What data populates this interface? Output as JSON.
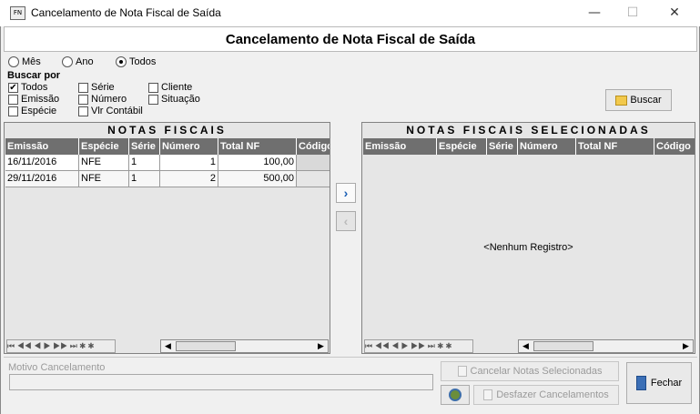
{
  "window": {
    "title": "Cancelamento de Nota Fiscal de Saída",
    "icon_text": "FN",
    "minimize": "—",
    "maximize": "☐",
    "close": "✕"
  },
  "header": {
    "title": "Cancelamento de Nota Fiscal de Saída"
  },
  "period": {
    "options": [
      "Mês",
      "Ano",
      "Todos"
    ],
    "selected": "Todos"
  },
  "search": {
    "label": "Buscar por",
    "checks": [
      {
        "label": "Todos",
        "checked": true
      },
      {
        "label": "Série",
        "checked": false
      },
      {
        "label": "Cliente",
        "checked": false
      },
      {
        "label": "Emissão",
        "checked": false
      },
      {
        "label": "Número",
        "checked": false
      },
      {
        "label": "Situação",
        "checked": false
      },
      {
        "label": "Espécie",
        "checked": false
      },
      {
        "label": "Vlr Contábil",
        "checked": false
      }
    ],
    "button": "Buscar"
  },
  "left_grid": {
    "title": "NOTAS FISCAIS",
    "columns": [
      "Emissão",
      "Espécie",
      "Série",
      "Número",
      "Total NF",
      "Código"
    ],
    "rows": [
      [
        "16/11/2016",
        "NFE",
        "1",
        "1",
        "100,00",
        ""
      ],
      [
        "29/11/2016",
        "NFE",
        "1",
        "2",
        "500,00",
        ""
      ]
    ]
  },
  "right_grid": {
    "title": "NOTAS FISCAIS SELECIONADAS",
    "columns": [
      "Emissão",
      "Espécie",
      "Série",
      "Número",
      "Total NF",
      "Código"
    ],
    "empty_text": "<Nenhum Registro>"
  },
  "navigator": {
    "glyphs": "⏮ ◀◀ ◀ ▶ ▶▶ ⏭ ✱ ✱"
  },
  "transfer": {
    "add": "›",
    "remove": "‹"
  },
  "footer": {
    "reason_label": "Motivo Cancelamento",
    "reason_value": "",
    "cancel_button": "Cancelar Notas Selecionadas",
    "undo_button": "Desfazer Cancelamentos",
    "close_button": "Fechar"
  }
}
